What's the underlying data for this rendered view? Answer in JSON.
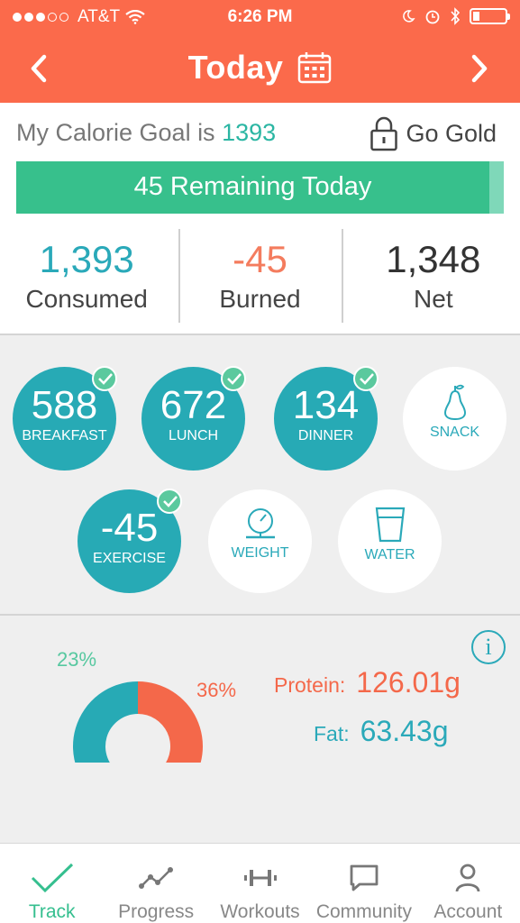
{
  "status_bar": {
    "carrier": "AT&T",
    "time": "6:26 PM",
    "signal_icon": "signal-dots-icon",
    "wifi_icon": "wifi-icon",
    "right_icons": [
      "moon-icon",
      "alarm-icon",
      "bluetooth-icon",
      "battery-icon"
    ]
  },
  "header": {
    "title": "Today",
    "calendar_icon": "calendar-icon",
    "prev_icon": "chevron-left-icon",
    "next_icon": "chevron-right-icon",
    "accent": "#fb6a4b"
  },
  "goal": {
    "prefix": "My Calorie Goal is",
    "value": "1393",
    "gold_label": "Go Gold",
    "lock_icon": "lock-icon",
    "remaining_label": "45 Remaining Today",
    "progress_fraction": 0.97
  },
  "stats": [
    {
      "value": "1,393",
      "label": "Consumed"
    },
    {
      "value": "-45",
      "label": "Burned"
    },
    {
      "value": "1,348",
      "label": "Net"
    }
  ],
  "meals": {
    "breakfast": {
      "value": "588",
      "label": "BREAKFAST",
      "logged": true
    },
    "lunch": {
      "value": "672",
      "label": "LUNCH",
      "logged": true
    },
    "dinner": {
      "value": "134",
      "label": "DINNER",
      "logged": true
    },
    "snack": {
      "label": "SNACK",
      "icon": "pear-icon",
      "logged": false
    },
    "exercise": {
      "value": "-45",
      "label": "EXERCISE",
      "logged": true
    },
    "weight": {
      "label": "WEIGHT",
      "icon": "scale-icon",
      "logged": false
    },
    "water": {
      "label": "WATER",
      "icon": "glass-icon",
      "logged": false
    }
  },
  "chart_data": {
    "type": "pie",
    "labels": [
      "23%",
      "36%"
    ],
    "segments": [
      {
        "percent": 36,
        "color": "#f4684a"
      },
      {
        "percent": 23,
        "color": "#7ed6b4"
      },
      {
        "percent": 41,
        "color": "#27aab5"
      }
    ]
  },
  "macros": {
    "protein_label": "Protein:",
    "protein_value": "126.01g",
    "fat_label": "Fat:",
    "fat_value": "63.43g",
    "info_icon": "info-icon",
    "info_text": "i"
  },
  "tabs": [
    {
      "label": "Track",
      "icon": "check-icon",
      "active": true
    },
    {
      "label": "Progress",
      "icon": "progress-chart-icon",
      "active": false
    },
    {
      "label": "Workouts",
      "icon": "dumbbell-icon",
      "active": false
    },
    {
      "label": "Community",
      "icon": "chat-icon",
      "active": false
    },
    {
      "label": "Account",
      "icon": "person-icon",
      "active": false
    }
  ]
}
